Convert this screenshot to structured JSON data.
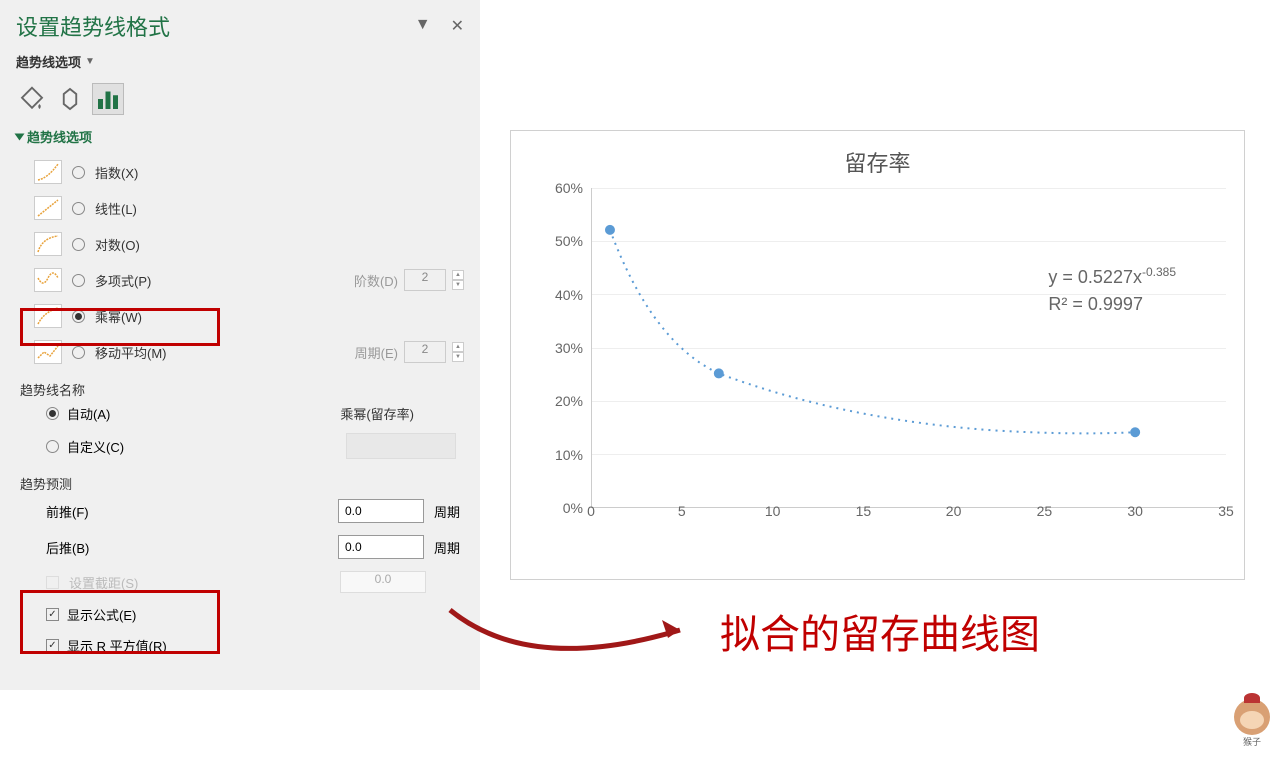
{
  "panel": {
    "title": "设置趋势线格式",
    "dropdown": "趋势线选项",
    "section": "趋势线选项",
    "options": [
      {
        "label": "指数(X)",
        "checked": false
      },
      {
        "label": "线性(L)",
        "checked": false
      },
      {
        "label": "对数(O)",
        "checked": false
      },
      {
        "label": "多项式(P)",
        "checked": false,
        "extra_label": "阶数(D)",
        "extra_value": "2"
      },
      {
        "label": "乘幂(W)",
        "checked": true
      },
      {
        "label": "移动平均(M)",
        "checked": false,
        "extra_label": "周期(E)",
        "extra_value": "2"
      }
    ],
    "name_section": "趋势线名称",
    "name_auto": "自动(A)",
    "name_custom": "自定义(C)",
    "name_value": "乘幂(留存率)",
    "forecast_section": "趋势预测",
    "forecast_forward": "前推(F)",
    "forecast_backward": "后推(B)",
    "forecast_value": "0.0",
    "forecast_unit": "周期",
    "intercept": "设置截距(S)",
    "intercept_value": "0.0",
    "show_equation": "显示公式(E)",
    "show_r2": "显示 R 平方值(R)"
  },
  "chart_data": {
    "type": "scatter",
    "title": "留存率",
    "x": [
      1,
      7,
      30
    ],
    "y": [
      0.52,
      0.25,
      0.14
    ],
    "xlim": [
      0,
      35
    ],
    "ylim": [
      0,
      0.6
    ],
    "x_ticks": [
      0,
      5,
      10,
      15,
      20,
      25,
      30,
      35
    ],
    "y_ticks": [
      "0%",
      "10%",
      "20%",
      "30%",
      "40%",
      "50%",
      "60%"
    ],
    "trendline": "power",
    "equation": "y = 0.5227x",
    "equation_exp": "-0.385",
    "r2": "R² = 0.9997"
  },
  "annotation": "拟合的留存曲线图",
  "monkey": "猴子"
}
